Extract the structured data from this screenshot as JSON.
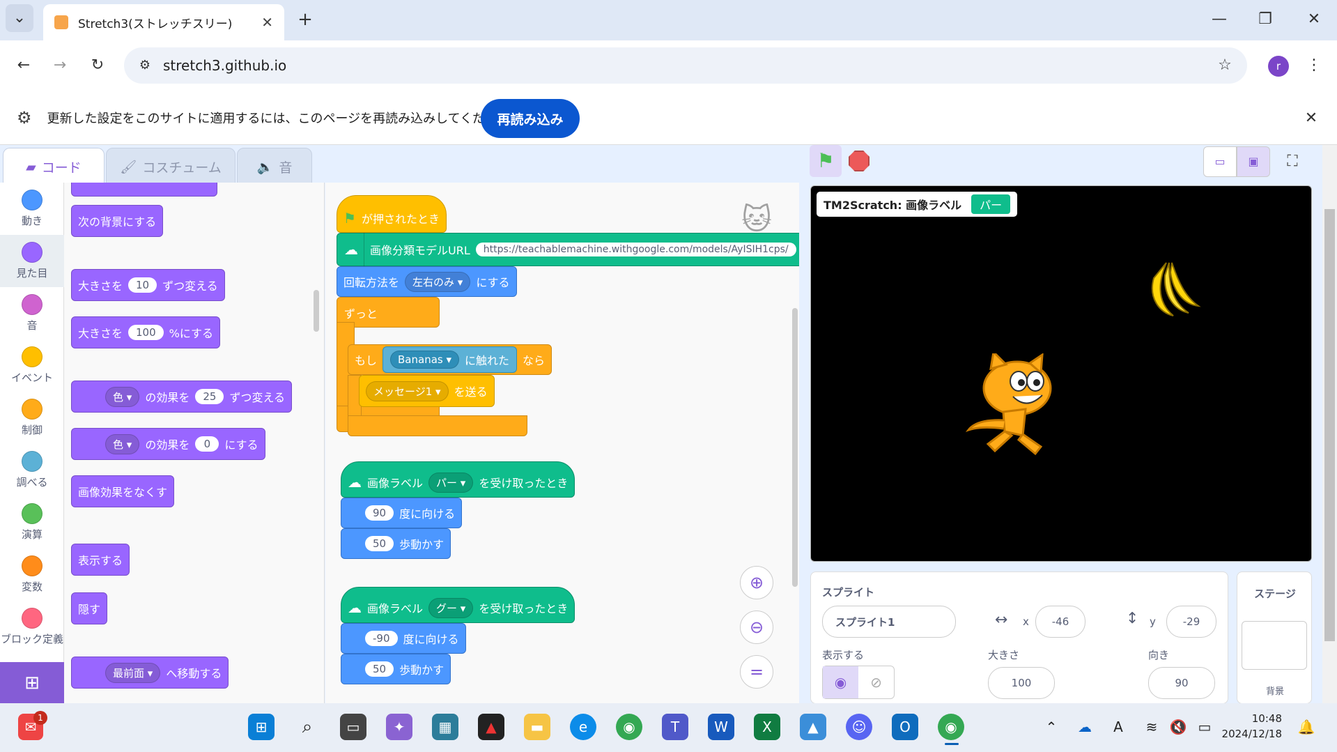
{
  "browser": {
    "tab_title": "Stretch3(ストレッチスリー)",
    "url": "stretch3.github.io",
    "profile_initial": "r"
  },
  "infobar": {
    "message": "更新した設定をこのサイトに適用するには、このページを再読み込みしてください",
    "reload_label": "再読み込み"
  },
  "editor_tabs": {
    "code": "コード",
    "costumes": "コスチューム",
    "sounds": "音"
  },
  "categories": [
    {
      "label": "動き",
      "color": "#4c97ff"
    },
    {
      "label": "見た目",
      "color": "#9966ff"
    },
    {
      "label": "音",
      "color": "#cf63cf"
    },
    {
      "label": "イベント",
      "color": "#ffbf00"
    },
    {
      "label": "制御",
      "color": "#ffab19"
    },
    {
      "label": "調べる",
      "color": "#5cb1d6"
    },
    {
      "label": "演算",
      "color": "#59c059"
    },
    {
      "label": "変数",
      "color": "#ff8c1a"
    },
    {
      "label": "ブロック定義",
      "color": "#ff6680"
    }
  ],
  "palette": {
    "next_backdrop": "次の背景にする",
    "change_size_a": "大きさを",
    "change_size_val": "10",
    "change_size_b": "ずつ変える",
    "set_size_a": "大きさを",
    "set_size_val": "100",
    "set_size_b": "%にする",
    "change_effect_drop": "色",
    "change_effect_a": "の効果を",
    "change_effect_val": "25",
    "change_effect_b": "ずつ変える",
    "set_effect_drop": "色",
    "set_effect_a": "の効果を",
    "set_effect_val": "0",
    "set_effect_b": "にする",
    "clear_effects": "画像効果をなくす",
    "show": "表示する",
    "hide": "隠す",
    "goto_layer_drop": "最前面",
    "goto_layer_b": "へ移動する"
  },
  "script": {
    "flag_hat": "が押されたとき",
    "model_label": "画像分類モデルURL",
    "model_url": "https://teachablemachine.withgoogle.com/models/AyISIH1cps/",
    "rotation_a": "回転方法を",
    "rotation_drop": "左右のみ",
    "rotation_b": "にする",
    "forever": "ずっと",
    "if_a": "もし",
    "touch_drop": "Bananas",
    "touch_b": "に触れた",
    "if_b": "なら",
    "broadcast_drop": "メッセージ1",
    "broadcast_b": "を送る",
    "hat1_a": "画像ラベル",
    "hat1_drop": "パー",
    "hat1_b": "を受け取ったとき",
    "point1_val": "90",
    "point1_b": "度に向ける",
    "move1_val": "50",
    "move1_b": "歩動かす",
    "hat2_a": "画像ラベル",
    "hat2_drop": "グー",
    "hat2_b": "を受け取ったとき",
    "point2_val": "-90",
    "point2_b": "度に向ける",
    "move2_val": "50",
    "move2_b": "歩動かす"
  },
  "stage": {
    "monitor_label": "TM2Scratch: 画像ラベル",
    "monitor_value": "パー"
  },
  "sprite_info": {
    "heading": "スプライト",
    "name": "スプライト1",
    "x_label": "x",
    "x": "-46",
    "y_label": "y",
    "y": "-29",
    "show_label": "表示する",
    "size_label": "大きさ",
    "size": "100",
    "direction_label": "向き",
    "direction": "90"
  },
  "stage_panel": {
    "heading": "ステージ",
    "backdrop_label": "背景"
  },
  "taskbar": {
    "time": "10:48",
    "date": "2024/12/18",
    "badge": "1"
  }
}
